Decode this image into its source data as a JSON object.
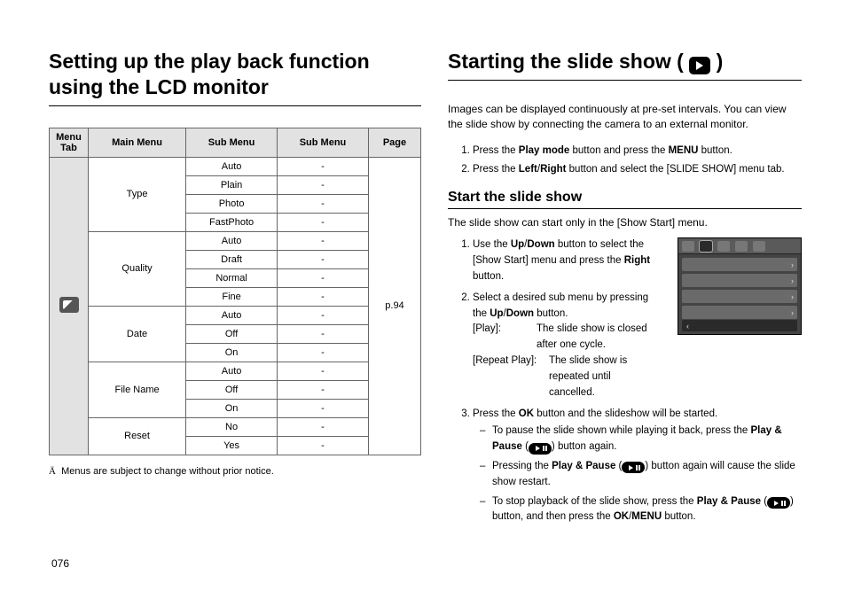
{
  "left": {
    "heading": "Setting up the play back function using the LCD monitor",
    "table": {
      "headers": [
        "Menu Tab",
        "Main Menu",
        "Sub Menu",
        "Sub Menu",
        "Page"
      ],
      "page_ref": "p.94",
      "groups": [
        {
          "main": "Type",
          "rows": [
            {
              "sub1": "Auto",
              "sub2": "-"
            },
            {
              "sub1": "Plain",
              "sub2": "-"
            },
            {
              "sub1": "Photo",
              "sub2": "-"
            },
            {
              "sub1": "FastPhoto",
              "sub2": "-"
            }
          ]
        },
        {
          "main": "Quality",
          "rows": [
            {
              "sub1": "Auto",
              "sub2": "-"
            },
            {
              "sub1": "Draft",
              "sub2": "-"
            },
            {
              "sub1": "Normal",
              "sub2": "-"
            },
            {
              "sub1": "Fine",
              "sub2": "-"
            }
          ]
        },
        {
          "main": "Date",
          "rows": [
            {
              "sub1": "Auto",
              "sub2": "-"
            },
            {
              "sub1": "Off",
              "sub2": "-"
            },
            {
              "sub1": "On",
              "sub2": "-"
            }
          ]
        },
        {
          "main": "File Name",
          "rows": [
            {
              "sub1": "Auto",
              "sub2": "-"
            },
            {
              "sub1": "Off",
              "sub2": "-"
            },
            {
              "sub1": "On",
              "sub2": "-"
            }
          ]
        },
        {
          "main": "Reset",
          "rows": [
            {
              "sub1": "No",
              "sub2": "-"
            },
            {
              "sub1": "Yes",
              "sub2": "-"
            }
          ]
        }
      ]
    },
    "footnote_prefix": "Ä",
    "footnote": "Menus are subject to change without prior notice."
  },
  "right": {
    "heading_a": "Starting the slide show (",
    "heading_b": ")",
    "intro": "Images can be displayed continuously at pre-set intervals. You can view the slide show by connecting the camera to an external monitor.",
    "pre_steps": [
      {
        "a": "Press the ",
        "b": "Play mode",
        "c": " button and press the ",
        "d": "MENU",
        "e": " button."
      },
      {
        "a": "Press the ",
        "b": "Left",
        "c": "/",
        "d": "Right",
        "e": " button and select the [SLIDE SHOW] menu tab."
      }
    ],
    "sub_heading": "Start the slide show",
    "sub_intro": "The slide show can start only in the [Show Start] menu.",
    "steps2": {
      "s1a": "Use the ",
      "s1b": "Up",
      "s1c": "/",
      "s1d": "Down",
      "s1e": " button to select the [Show Start] menu and press the ",
      "s1f": "Right",
      "s1g": " button.",
      "s2a": "Select a desired sub menu by pressing the ",
      "s2b": "Up",
      "s2c": "/",
      "s2d": "Down",
      "s2e": " button.",
      "def1k": "[Play]:",
      "def1v": "The slide show is closed after one cycle.",
      "def2k": "[Repeat Play]:",
      "def2v": "The slide show is repeated until cancelled.",
      "s3a": "Press the ",
      "s3b": "OK",
      "s3c": " button and the slideshow will be started.",
      "d1a": "To pause the slide shown while playing it back, press the ",
      "d1b": "Play & Pause",
      "d1c": " (",
      "d1d": ") button again.",
      "d2a": "Pressing the ",
      "d2b": "Play & Pause",
      "d2c": " (",
      "d2d": ") button again will cause the slide show restart.",
      "d3a": "To stop playback of the slide show, press the ",
      "d3b": "Play & Pause",
      "d3c": " (",
      "d3d": ") button, and then press the ",
      "d3e": "OK",
      "d3f": "/",
      "d3g": "MENU",
      "d3h": " button."
    }
  },
  "page_number": "076"
}
